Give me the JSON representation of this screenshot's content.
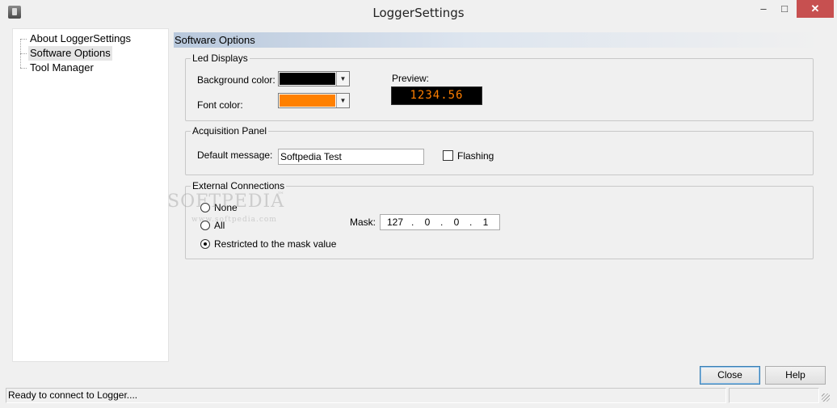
{
  "window": {
    "title": "LoggerSettings",
    "minimize_glyph": "–",
    "maximize_glyph": "□",
    "close_glyph": "✕"
  },
  "tree": {
    "items": [
      {
        "label": "About LoggerSettings",
        "selected": false
      },
      {
        "label": "Software Options",
        "selected": true
      },
      {
        "label": "Tool Manager",
        "selected": false
      }
    ]
  },
  "section": {
    "title": "Software Options"
  },
  "led_displays": {
    "group_label": "Led Displays",
    "background_color_label": "Background color:",
    "background_color": "#000000",
    "font_color_label": "Font color:",
    "font_color": "#ff8000",
    "preview_label": "Preview:",
    "preview_value": "1234.56"
  },
  "acquisition_panel": {
    "group_label": "Acquisition Panel",
    "default_message_label": "Default message:",
    "default_message_value": "Softpedia Test",
    "flashing_label": "Flashing",
    "flashing_checked": false
  },
  "external_connections": {
    "group_label": "External Connections",
    "options": [
      {
        "label": "None",
        "checked": false
      },
      {
        "label": "All",
        "checked": false
      },
      {
        "label": "Restricted to the mask value",
        "checked": true
      }
    ],
    "mask_label": "Mask:",
    "mask": [
      "127",
      "0",
      "0",
      "1"
    ]
  },
  "watermark": {
    "text": "SOFTPEDIA",
    "sub": "www.softpedia.com",
    "mark": "™"
  },
  "buttons": {
    "close": "Close",
    "help": "Help"
  },
  "status": {
    "text": "Ready to connect to Logger...."
  },
  "colors": {
    "accent_header": "#b8c8dc",
    "led_text": "#ff7f00",
    "close_button": "#c75050"
  }
}
